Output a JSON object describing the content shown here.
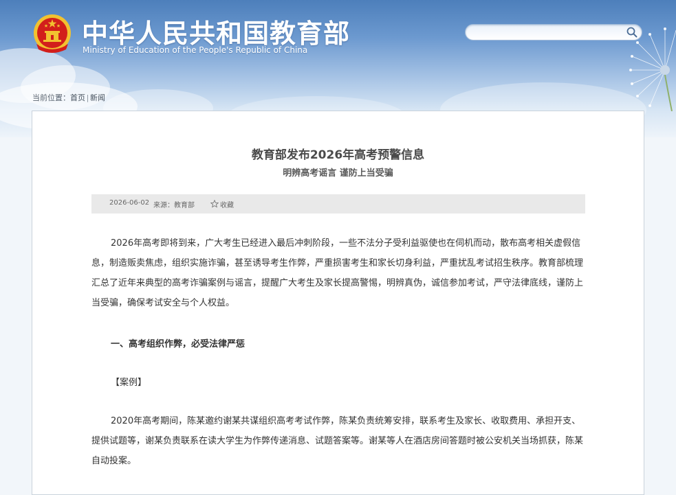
{
  "header": {
    "site_title": "中华人民共和国教育部",
    "site_subtitle": "Ministry of Education of the People's Republic of China",
    "search_placeholder": ""
  },
  "breadcrumb": {
    "label": "当前位置：",
    "items": [
      "首页",
      "新闻"
    ],
    "separator": "|"
  },
  "article": {
    "title": "教育部发布2026年高考预警信息",
    "subtitle": "明辨高考谣言 谨防上当受骗",
    "date": "2026-06-02",
    "source": "来源：教育部",
    "favorite_label": "收藏",
    "paragraphs": [
      "2026年高考即将到来，广大考生已经进入最后冲刺阶段，一些不法分子受利益驱使也在伺机而动，散布高考相关虚假信息，制造贩卖焦虑，组织实施诈骗，甚至诱导考生作弊，严重损害考生和家长切身利益，严重扰乱考试招生秩序。教育部梳理汇总了近年来典型的高考诈骗案例与谣言，提醒广大考生及家长提高警惕，明辨真伪，诚信参加考试，严守法律底线，谨防上当受骗，确保考试安全与个人权益。",
      "2020年高考期间，陈某邀约谢某共谋组织高考考试作弊，陈某负责统筹安排，联系考生及家长、收取费用、承担开支、提供试题等，谢某负责联系在读大学生为作弊传递消息、试题答案等。谢某等人在酒店房间答题时被公安机关当场抓获，陈某自动投案。"
    ],
    "section_heading": "一、高考组织作弊，必受法律严惩",
    "case_label": "【案例】"
  },
  "colors": {
    "banner_top": "#4d7fbb",
    "emblem_red": "#d21f1b",
    "emblem_gold": "#f2c230",
    "meta_bar_bg": "#e9e9e9",
    "body_text": "#333333"
  },
  "icons": {
    "emblem": "national-emblem-icon",
    "search": "search-icon",
    "favorite": "star-outline-icon"
  }
}
